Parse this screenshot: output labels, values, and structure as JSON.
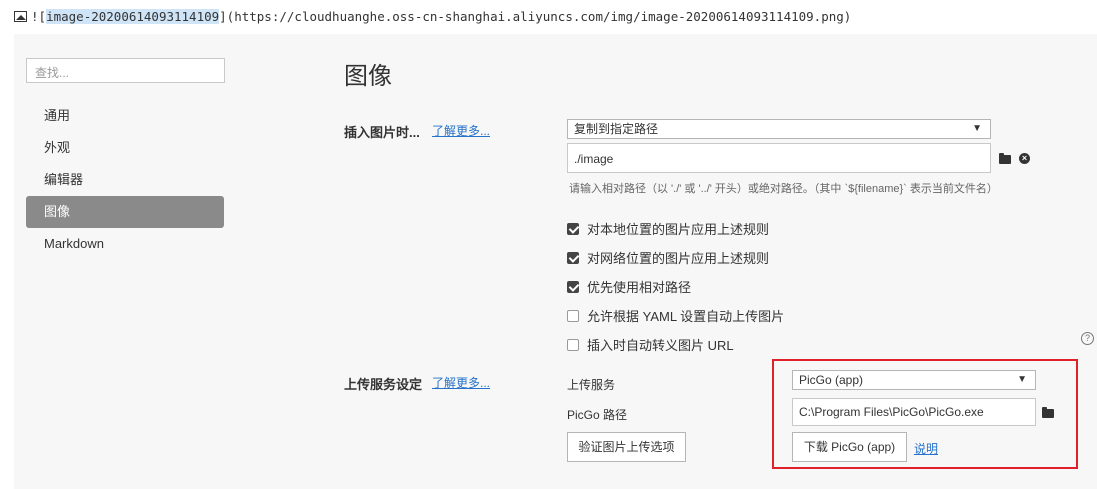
{
  "header_line": {
    "prefix": "![",
    "alt_text": "image-20200614093114109",
    "suffix": "](https://cloudhuanghe.oss-cn-shanghai.aliyuncs.com/img/image-20200614093114109.png)"
  },
  "sidebar": {
    "search_placeholder": "查找...",
    "items": [
      {
        "label": "通用",
        "active": false
      },
      {
        "label": "外观",
        "active": false
      },
      {
        "label": "编辑器",
        "active": false
      },
      {
        "label": "图像",
        "active": true
      },
      {
        "label": "Markdown",
        "active": false
      }
    ]
  },
  "page_title": "图像",
  "insert_section": {
    "label": "插入图片时...",
    "learn_more": "了解更多...",
    "select_value": "复制到指定路径",
    "path_value": "./image",
    "hint": "请输入相对路径（以 './' 或 '../' 开头）或绝对路径。（其中 `${filename}` 表示当前文件名）",
    "checkboxes": [
      {
        "label": "对本地位置的图片应用上述规则",
        "checked": true
      },
      {
        "label": "对网络位置的图片应用上述规则",
        "checked": true
      },
      {
        "label": "优先使用相对路径",
        "checked": true
      },
      {
        "label": "允许根据 YAML 设置自动上传图片",
        "checked": false
      },
      {
        "label": "插入时自动转义图片 URL",
        "checked": false
      }
    ],
    "help_glyph": "?"
  },
  "upload_section": {
    "label": "上传服务设定",
    "learn_more": "了解更多...",
    "service_label": "上传服务",
    "service_value": "PicGo (app)",
    "path_label": "PicGo 路径",
    "path_value": "C:\\Program Files\\PicGo\\PicGo.exe",
    "validate_button": "验证图片上传选项",
    "download_button": "下载 PicGo (app)",
    "explain_link": "说明"
  },
  "icons": {
    "dropdown": "▼",
    "clear": "×"
  },
  "colors": {
    "panel_bg": "#f7f7f7",
    "active_nav_bg": "#8a8a8a",
    "link": "#2672c9",
    "highlight_box": "#e0202a"
  }
}
